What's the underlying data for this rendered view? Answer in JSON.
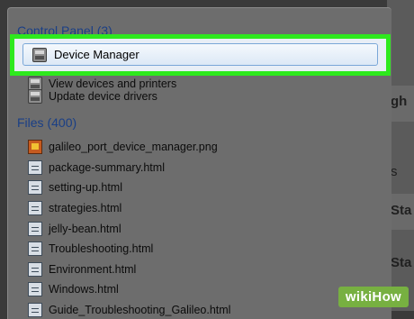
{
  "control_panel": {
    "header_label": "Control Panel",
    "header_count": "(3)",
    "items": [
      {
        "label": "Device Manager",
        "icon": "device-manager-icon"
      },
      {
        "label": "View devices and printers",
        "icon": "devices-printers-icon"
      },
      {
        "label": "Update device drivers",
        "icon": "device-drivers-icon"
      }
    ]
  },
  "files": {
    "header_label": "Files",
    "header_count": "(400)",
    "items": [
      {
        "label": "galileo_port_device_manager.png",
        "icon": "image-file-icon"
      },
      {
        "label": "package-summary.html",
        "icon": "html-file-icon"
      },
      {
        "label": "setting-up.html",
        "icon": "html-file-icon"
      },
      {
        "label": "strategies.html",
        "icon": "html-file-icon"
      },
      {
        "label": "jelly-bean.html",
        "icon": "html-file-icon"
      },
      {
        "label": "Troubleshooting.html",
        "icon": "html-file-icon"
      },
      {
        "label": "Environment.html",
        "icon": "html-file-icon"
      },
      {
        "label": "Windows.html",
        "icon": "html-file-icon"
      },
      {
        "label": "Guide_Troubleshooting_Galileo.html",
        "icon": "html-file-icon"
      }
    ]
  },
  "background_window": {
    "fragments": [
      "gh",
      "s",
      "Sta",
      "Sta"
    ]
  },
  "watermark": {
    "text": "wikiHow"
  },
  "colors": {
    "highlight": "#2ee91d",
    "group_header": "#1a3f86",
    "selection": "#dce8f6"
  }
}
